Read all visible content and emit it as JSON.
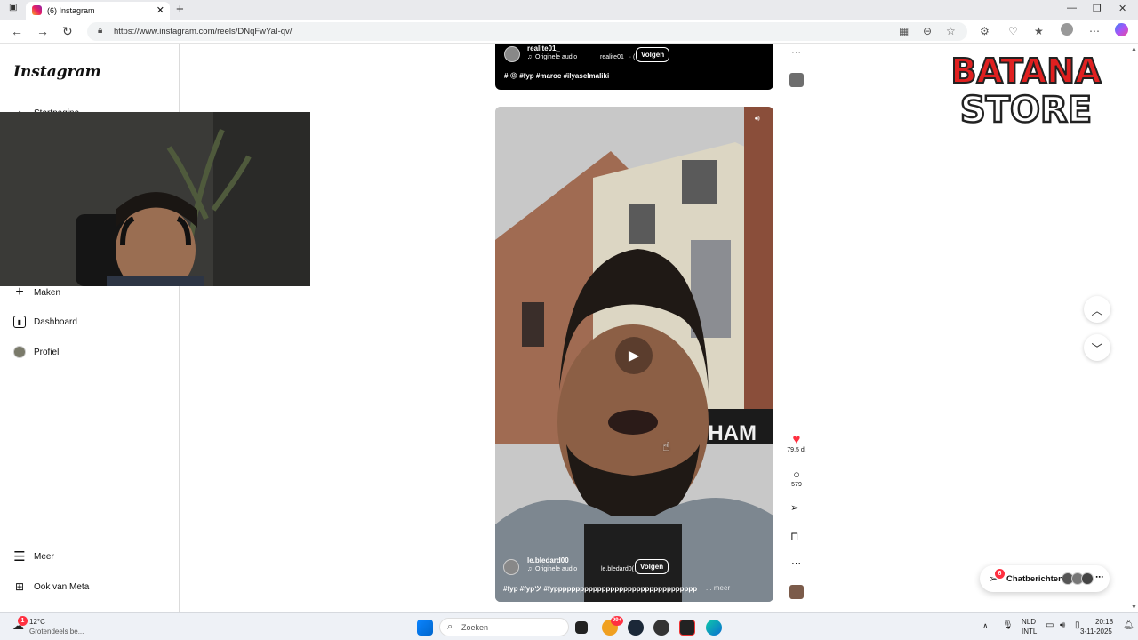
{
  "browser": {
    "tab_title": "(6) Instagram",
    "url": "https://www.instagram.com/reels/DNqFwYaI-qv/"
  },
  "sidebar": {
    "logo": "Instagram",
    "items": [
      {
        "label": "Startpagina",
        "icon": "home-icon"
      },
      {
        "label": "Maken",
        "icon": "plus-icon"
      },
      {
        "label": "Dashboard",
        "icon": "dashboard-icon"
      },
      {
        "label": "Profiel",
        "icon": "profile-avatar"
      },
      {
        "label": "Meer",
        "icon": "menu-icon"
      },
      {
        "label": "Ook van Meta",
        "icon": "meta-icon"
      }
    ]
  },
  "top_post": {
    "username": "realite01_",
    "audio": "Originele audio",
    "audio_secondary": "realite01_ · (",
    "follow_label": "Volgen",
    "caption": "# 😡 #fyp #maroc #ilyaselmaliki"
  },
  "reel": {
    "username": "le.bledard00",
    "audio": "Originele audio",
    "audio_secondary": "le.bledard0(",
    "follow_label": "Volgen",
    "caption": "#fyp #fypツ #fyppppppppppppppppppppppppppppppppp",
    "more_label": "... meer",
    "likes": "79,5 d.",
    "comments": "579"
  },
  "overlay_logo": {
    "line1": "BATANA",
    "line2": "STORE"
  },
  "chat": {
    "label": "Chatberichten",
    "badge": "6"
  },
  "taskbar": {
    "weather_temp": "12°C",
    "weather_desc": "Grotendeels be...",
    "weather_badge": "1",
    "search_placeholder": "Zoeken",
    "app_badge": "99+",
    "lang1": "NLD",
    "lang2": "INTL",
    "time": "20:18",
    "date": "3-11-2025"
  }
}
